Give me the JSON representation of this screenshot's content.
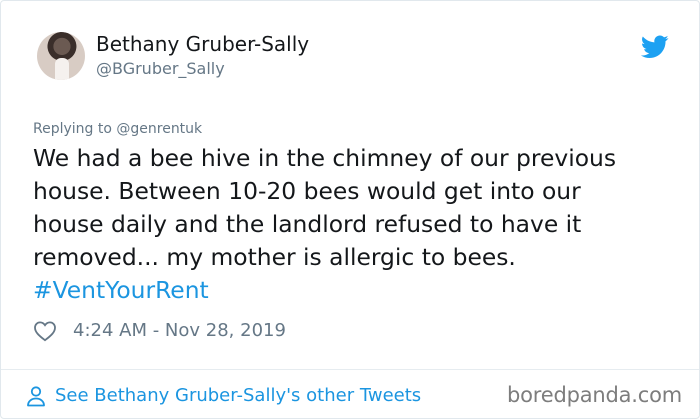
{
  "tweet": {
    "author": {
      "display_name": "Bethany Gruber-Sally",
      "handle": "@BGruber_Sally",
      "avatar_icon": "profile-photo"
    },
    "replying_to": "Replying to @genrentuk",
    "text_lines": [
      "We had a bee hive in the chimney of our previous",
      "house. Between 10-20 bees would get into our",
      "house daily and the landlord refused to have it",
      "removed... my mother is allergic to bees."
    ],
    "hashtag": "#VentYourRent",
    "timestamp": "4:24 AM - Nov 28, 2019",
    "icons": {
      "brand": "twitter-bird-icon",
      "like": "heart-icon",
      "profile": "person-icon"
    }
  },
  "footer": {
    "link_label": "See Bethany Gruber-Sally's other Tweets"
  },
  "watermark": "boredpanda.com",
  "colors": {
    "twitter_blue": "#1b95e0",
    "text_primary": "#14171a",
    "text_secondary": "#657786",
    "border": "#e1e8ed"
  }
}
